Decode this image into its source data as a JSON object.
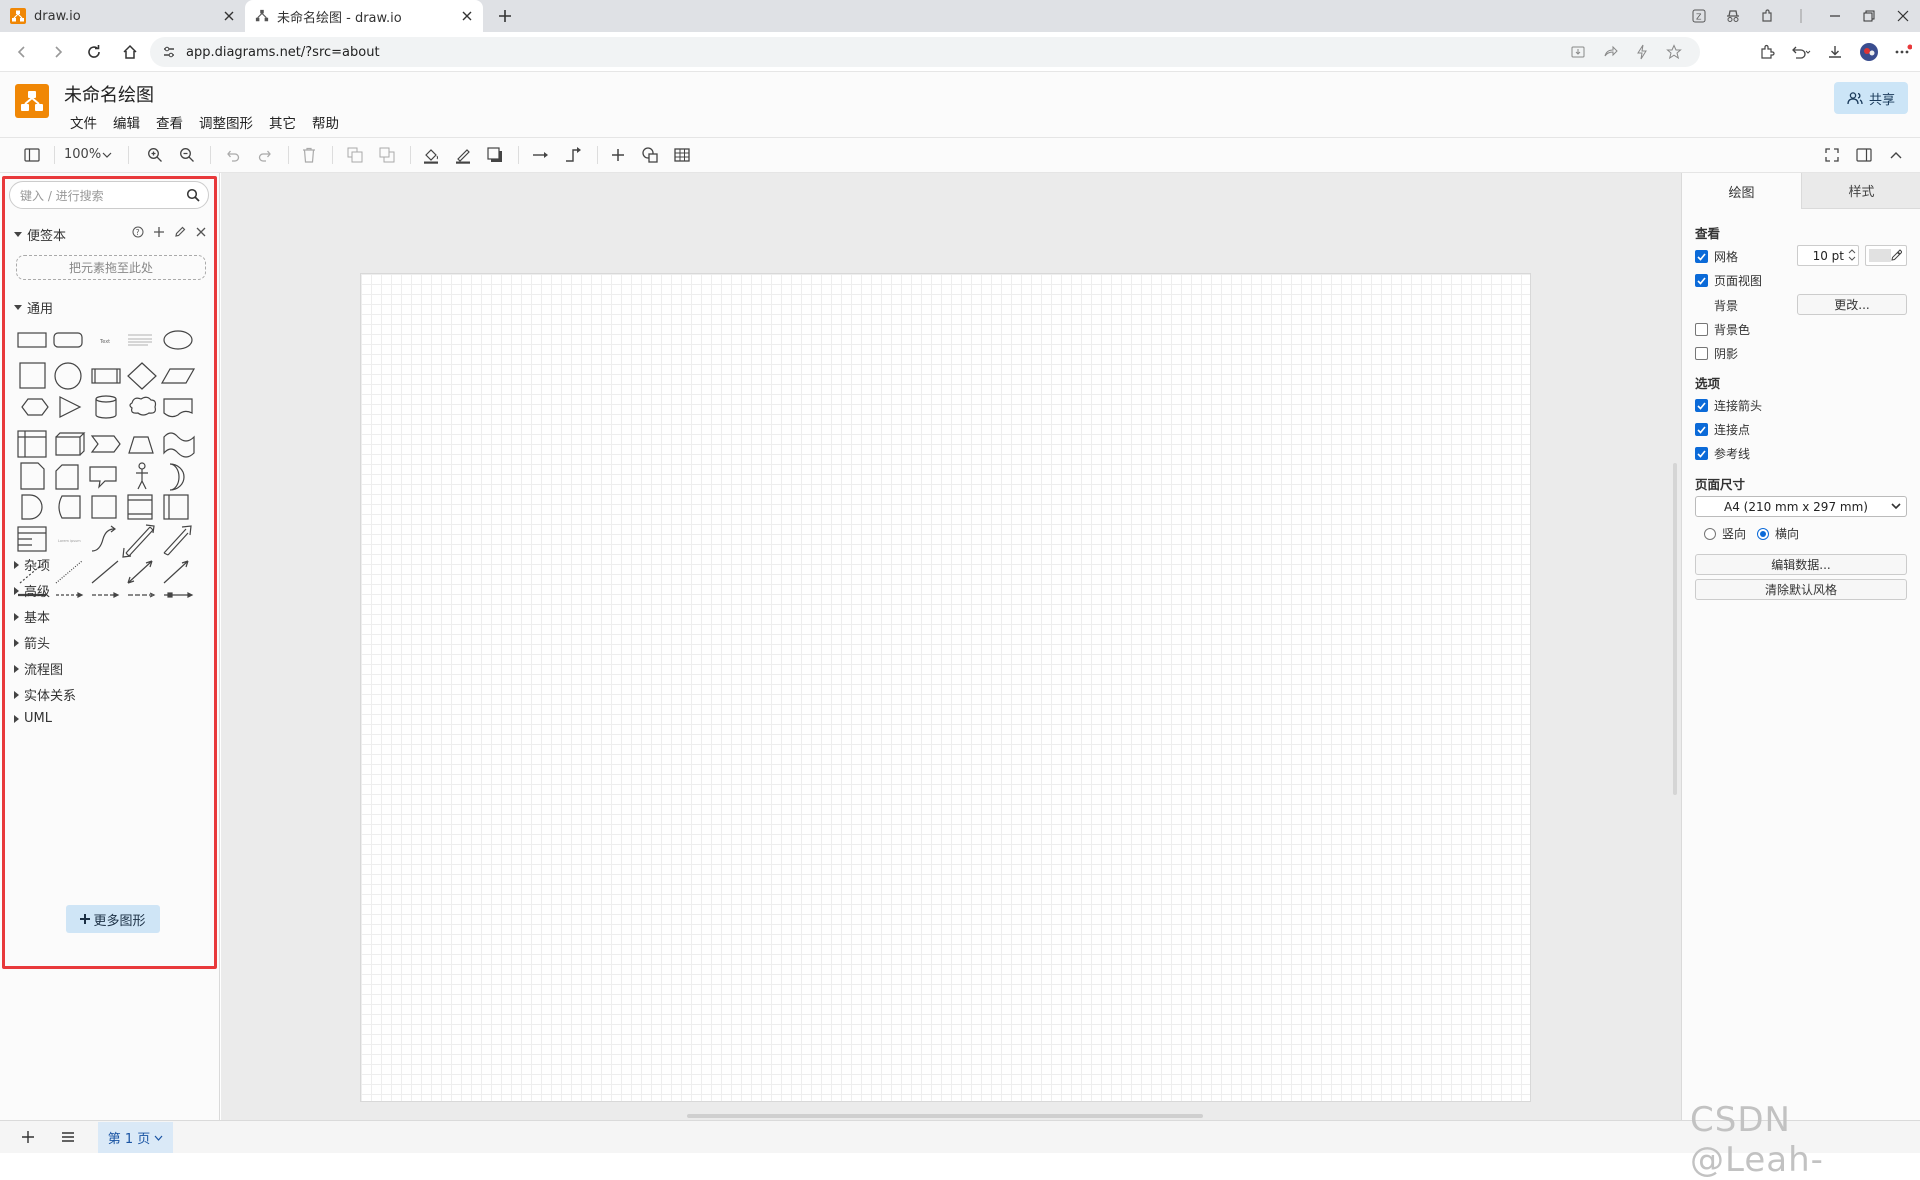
{
  "browser": {
    "tabs": [
      {
        "title": "draw.io",
        "active": false
      },
      {
        "title": "未命名绘图 - draw.io",
        "active": true
      }
    ],
    "url": "app.diagrams.net/?src=about"
  },
  "app": {
    "title": "未命名绘图",
    "menus": [
      "文件",
      "编辑",
      "查看",
      "调整图形",
      "其它",
      "帮助"
    ],
    "share_label": "共享"
  },
  "toolbar": {
    "zoom": "100%"
  },
  "left_panel": {
    "search_placeholder": "键入 / 进行搜索",
    "scratchpad": {
      "label": "便签本",
      "drop_hint": "把元素拖至此处"
    },
    "general": {
      "label": "通用"
    },
    "sections": [
      "杂项",
      "高级",
      "基本",
      "箭头",
      "流程图",
      "实体关系",
      "UML"
    ],
    "more_shapes": "更多图形"
  },
  "right_panel": {
    "tabs": [
      "绘图",
      "样式"
    ],
    "view": {
      "heading": "查看",
      "grid": {
        "label": "网格",
        "checked": true,
        "size": "10 pt"
      },
      "page_view": {
        "label": "页面视图",
        "checked": true
      },
      "background": {
        "label": "背景",
        "button": "更改..."
      },
      "background_color": {
        "label": "背景色",
        "checked": false
      },
      "shadow": {
        "label": "阴影",
        "checked": false
      }
    },
    "options": {
      "heading": "选项",
      "connection_arrows": {
        "label": "连接箭头",
        "checked": true
      },
      "connection_points": {
        "label": "连接点",
        "checked": true
      },
      "guides": {
        "label": "参考线",
        "checked": true
      }
    },
    "page_size": {
      "heading": "页面尺寸",
      "value": "A4 (210 mm x 297 mm)",
      "portrait": "竖向",
      "landscape": "横向",
      "selected": "横向"
    },
    "edit_data": "编辑数据...",
    "clear_style": "清除默认风格"
  },
  "footer": {
    "page_tab": "第 1 页"
  },
  "watermark": "CSDN @Leah-",
  "colors": {
    "accent": "#0b6ad8",
    "logo": "#f08705",
    "highlight": "#e8393b"
  }
}
